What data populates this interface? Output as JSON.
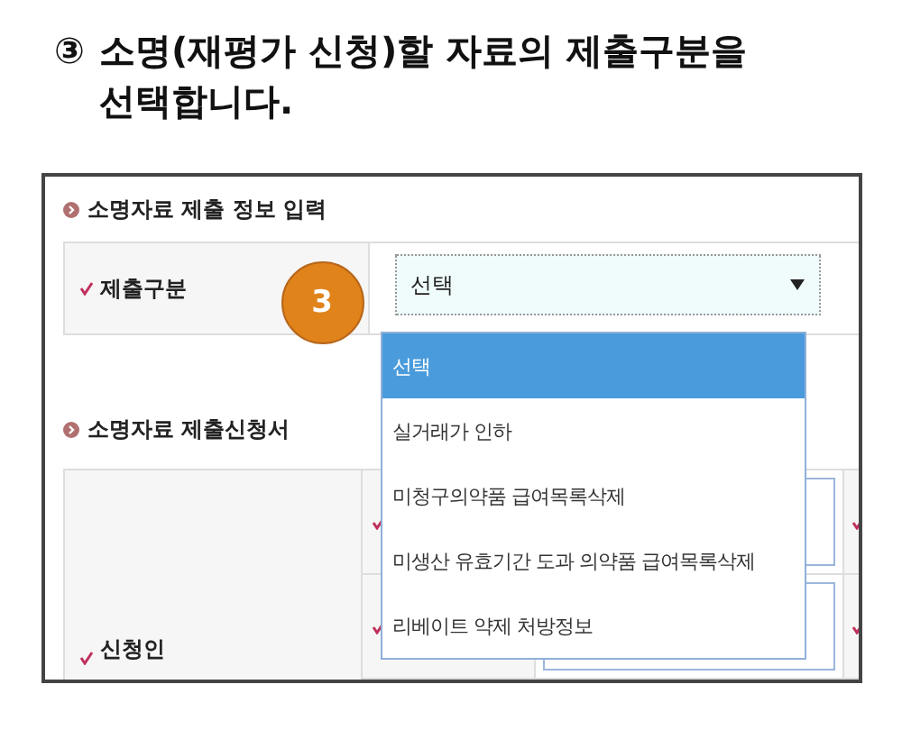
{
  "slide_title": {
    "number": "③",
    "text": "소명(재평가 신청)할 자료의 제출구분을 선택합니다."
  },
  "sections": [
    {
      "title": "소명자료 제출 정보 입력"
    },
    {
      "title": "소명자료 제출신청서"
    }
  ],
  "submit_field": {
    "label": "제출구분",
    "required": true,
    "value": "선택",
    "step_badge": "3"
  },
  "dropdown": {
    "expanded": true,
    "options": [
      {
        "label": "선택",
        "selected": true
      },
      {
        "label": "실거래가 인하",
        "selected": false
      },
      {
        "label": "미청구의약품 급여목록삭제",
        "selected": false
      },
      {
        "label": "미생산 유효기간 도과 의약품 급여목록삭제",
        "selected": false
      },
      {
        "label": "리베이트 약제 처방정보",
        "selected": false
      }
    ]
  },
  "applicant_table": {
    "label": "신청인",
    "required": true
  }
}
